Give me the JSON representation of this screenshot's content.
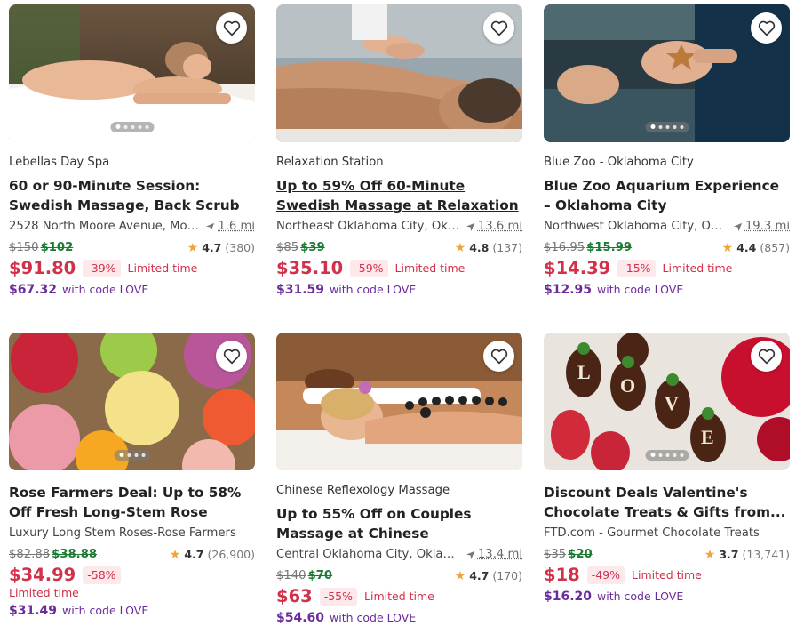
{
  "deals": [
    {
      "merchant": "Lebellas Day Spa",
      "title": "60 or 90-Minute Session: Swedish Massage, Back Scrub with Glow...",
      "location": "2528 North Moore Avenue, Moo...",
      "distance": "1.6 mi",
      "original_price": "$150",
      "deal_price": "$102",
      "rating": "4.7",
      "rating_count": "(380)",
      "sale_price": "$91.80",
      "discount": "-39%",
      "limited": "Limited time",
      "code_price": "$67.32",
      "code_text": "with code LOVE",
      "image": "massage-woman-towel"
    },
    {
      "merchant": "Relaxation Station",
      "title": "Up to 59% Off 60-Minute Swedish Massage at Relaxation Station",
      "location": "Northeast Oklahoma City, Okla...",
      "distance": "13.6 mi",
      "original_price": "$85",
      "deal_price": "$39",
      "rating": "4.8",
      "rating_count": "(137)",
      "sale_price": "$35.10",
      "discount": "-59%",
      "limited": "Limited time",
      "code_price": "$31.59",
      "code_text": "with code LOVE",
      "image": "back-massage-man"
    },
    {
      "merchant": "Blue Zoo - Oklahoma City",
      "title": "Blue Zoo Aquarium Experience – Oklahoma City",
      "location": "Northwest Oklahoma City, Okl...",
      "distance": "19.3 mi",
      "original_price": "$16.95",
      "deal_price": "$15.99",
      "rating": "4.4",
      "rating_count": "(857)",
      "sale_price": "$14.39",
      "discount": "-15%",
      "limited": "Limited time",
      "code_price": "$12.95",
      "code_text": "with code LOVE",
      "image": "hands-starfish-water"
    },
    {
      "merchant": "",
      "title": "Rose Farmers Deal: Up to 58% Off Fresh Long-Stem Rose Delivery",
      "location": "Luxury Long Stem Roses-Rose Farmers",
      "distance": "",
      "original_price": "$82.88",
      "deal_price": "$38.88",
      "rating": "4.7",
      "rating_count": "(26,900)",
      "sale_price": "$34.99",
      "discount": "-58%",
      "limited": "Limited time",
      "code_price": "$31.49",
      "code_text": "with code LOVE",
      "image": "rose-bouquets"
    },
    {
      "merchant": "Chinese Reflexology Massage",
      "title": "Up to 55% Off on Couples Massage at Chinese Reflexology Massage",
      "location": "Central Oklahoma City, Oklaho...",
      "distance": "13.4 mi",
      "original_price": "$140",
      "deal_price": "$70",
      "rating": "4.7",
      "rating_count": "(170)",
      "sale_price": "$63",
      "discount": "-55%",
      "limited": "Limited time",
      "code_price": "$54.60",
      "code_text": "with code LOVE",
      "image": "hot-stone-couple"
    },
    {
      "merchant": "",
      "title": "Discount Deals Valentine's Chocolate Treats & Gifts from...",
      "location": "FTD.com - Gourmet Chocolate Treats",
      "distance": "",
      "original_price": "$35",
      "deal_price": "$20",
      "rating": "3.7",
      "rating_count": "(13,741)",
      "sale_price": "$18",
      "discount": "-49%",
      "limited": "Limited time",
      "code_price": "$16.20",
      "code_text": "with code LOVE",
      "image": "chocolate-strawberries-love"
    }
  ],
  "icons": {
    "favorite": "heart-icon",
    "distance": "navigation-arrow-icon",
    "rating": "star-icon"
  },
  "colors": {
    "sale": "#d1314a",
    "deal": "#1b7b33",
    "code": "#6b2c9b",
    "star": "#f2a33a"
  }
}
